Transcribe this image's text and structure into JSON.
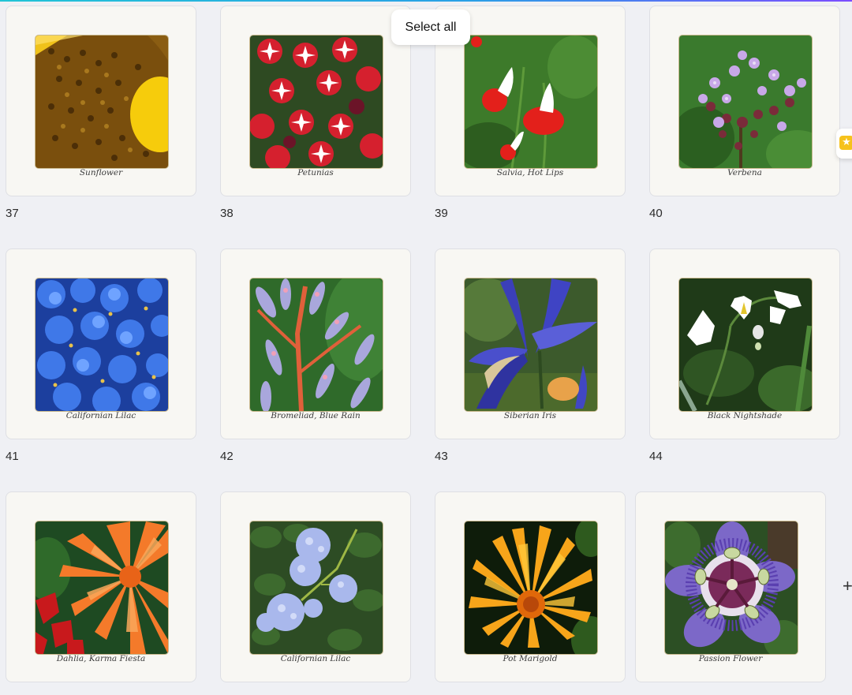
{
  "toolbar": {
    "select_all_label": "Select all"
  },
  "side_badge": {
    "icon": "star-icon"
  },
  "add_button": {
    "label": "+"
  },
  "pages": [
    {
      "number": "37",
      "caption": "Sunflower"
    },
    {
      "number": "38",
      "caption": "Petunias"
    },
    {
      "number": "39",
      "caption": "Salvia, Hot Lips"
    },
    {
      "number": "40",
      "caption": "Verbena"
    },
    {
      "number": "41",
      "caption": "Californian Lilac"
    },
    {
      "number": "42",
      "caption": "Bromeliad, Blue Rain"
    },
    {
      "number": "43",
      "caption": "Siberian Iris"
    },
    {
      "number": "44",
      "caption": "Black Nightshade"
    },
    {
      "number": "",
      "caption": "Dahlia, Karma Fiesta"
    },
    {
      "number": "",
      "caption": "Californian Lilac"
    },
    {
      "number": "",
      "caption": "Pot Marigold"
    },
    {
      "number": "",
      "caption": "Passion Flower"
    }
  ],
  "colors": {
    "background": "#eff0f4",
    "card": "#f8f7f3",
    "accent_gradient": [
      "#22c4d6",
      "#7b4dff"
    ],
    "badge_star": "#f6c21c"
  }
}
